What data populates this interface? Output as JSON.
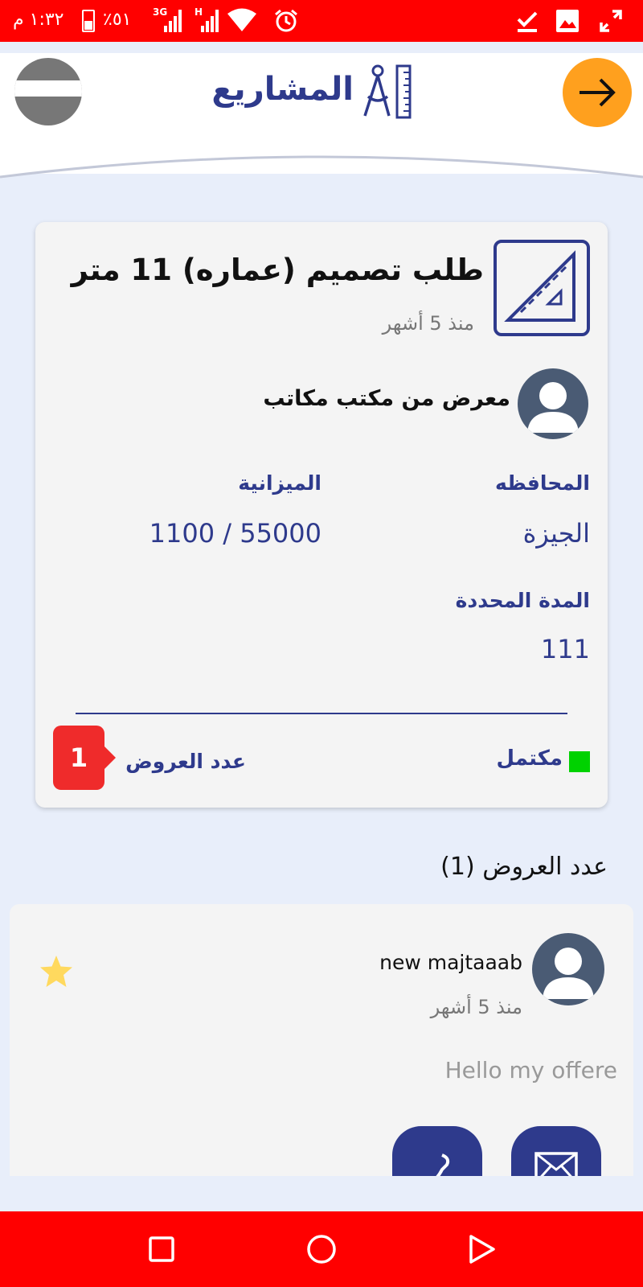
{
  "status_bar": {
    "time": "١:٣٢ م",
    "battery_percent": "٥١٪",
    "network_3g": "3G",
    "network_h": "H"
  },
  "header": {
    "title": "المشاريع",
    "back_icon": "arrow-right-icon",
    "title_icon": "compass-ruler-icon"
  },
  "project": {
    "title": "طلب تصميم (عماره) 11 متر",
    "time_ago": "منذ 5 أشهر",
    "owner_name": "معرض من مكتب مكاتب",
    "budget_label": "الميزانية",
    "budget_value": "1100 / 55000",
    "governorate_label": "المحافظه",
    "governorate_value": "الجيزة",
    "duration_label": "المدة المحددة",
    "duration_value": "111",
    "status_text": "مكتمل",
    "status_color": "#00d200",
    "offers_count_label": "عدد العروض",
    "offers_count": "1"
  },
  "offers": {
    "heading": "عدد العروض (1)",
    "items": [
      {
        "name": "new majtaaab",
        "time_ago": "منذ 5 أشهر",
        "message": "Hello my offere",
        "starred": true
      }
    ]
  },
  "colors": {
    "primary": "#2e3a8c",
    "accent": "#ffa01e",
    "system_bar": "#ff0000",
    "badge": "#ef2b2b",
    "background": "#e8eefa"
  }
}
